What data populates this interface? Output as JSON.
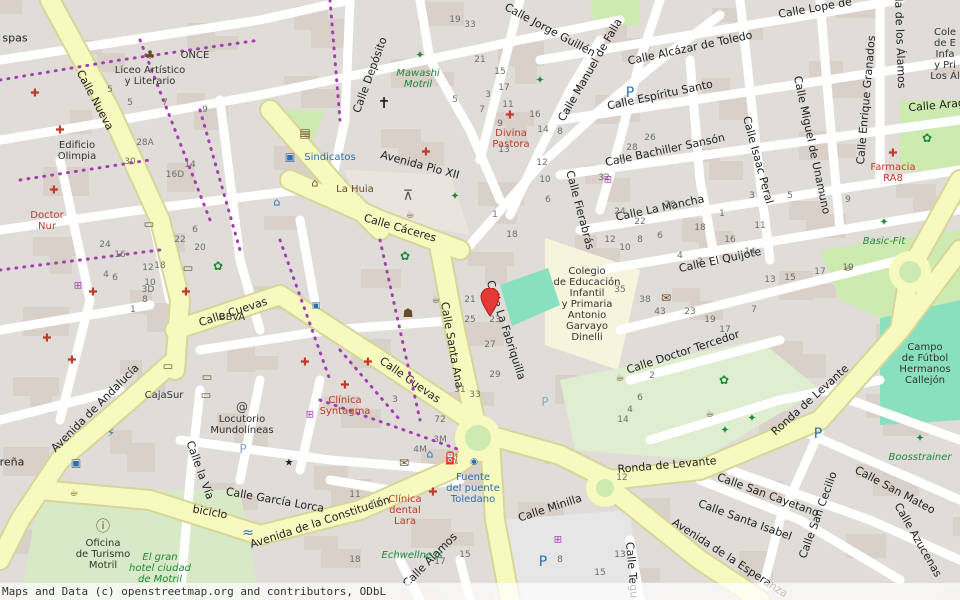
{
  "attribution": "Maps and Data (c) openstreetmap.org and contributors, ODbL",
  "colors": {
    "background": "#f2efe9",
    "block": "#e0dcd8",
    "building": "#d9d0c9",
    "major_road": "#f7fabf",
    "major_road_casing": "#d8d59a",
    "minor_road": "#ffffff",
    "park": "#cdebb0",
    "pitch": "#88e0be",
    "marker": "#e53935",
    "health": "#c0392b",
    "dots": "#a33fb2"
  },
  "marker": {
    "name": "location-pin"
  },
  "streets": [
    {
      "id": "calle-nueva",
      "text": "Calle Nueva"
    },
    {
      "id": "calle-deposito",
      "text": "Calle Depósito"
    },
    {
      "id": "avenida-pio-xii",
      "text": "Avenida Pio XII"
    },
    {
      "id": "calle-caceres",
      "text": "Calle Cáceres"
    },
    {
      "id": "calle-cuevas-1",
      "text": "Calle Cuevas"
    },
    {
      "id": "calle-cuevas-2",
      "text": "Calle Cuevas"
    },
    {
      "id": "calle-santa-ana",
      "text": "Calle Santa Ana"
    },
    {
      "id": "calle-la-fabriquilla",
      "text": "Calle La Fabriquilla"
    },
    {
      "id": "avenida-andalucia",
      "text": "Avenida de Andalucía"
    },
    {
      "id": "calle-la-via",
      "text": "Calle la Vía"
    },
    {
      "id": "calle-garcia-lorca",
      "text": "Calle García Lorca"
    },
    {
      "id": "biciclo",
      "text": "biciclo"
    },
    {
      "id": "avenida-constitucion",
      "text": "Avenida de la Constitución"
    },
    {
      "id": "calle-minilla",
      "text": "Calle Minilla"
    },
    {
      "id": "calle-alamos",
      "text": "Calle Álamos"
    },
    {
      "id": "ronda-levante-1",
      "text": "Ronda de Levante"
    },
    {
      "id": "ronda-levante-2",
      "text": "Ronda de Levante"
    },
    {
      "id": "avenida-esperanza",
      "text": "Avenida de la Esperanza"
    },
    {
      "id": "calle-doctor-tercedor",
      "text": "Calle Doctor Tercedor"
    },
    {
      "id": "calle-el-quijote",
      "text": "Calle El Quijote"
    },
    {
      "id": "calle-la-mancha",
      "text": "Calle La Mancha"
    },
    {
      "id": "calle-bachiller-sanson",
      "text": "Calle Bachiller Sansón"
    },
    {
      "id": "calle-espiritu-santo",
      "text": "Calle Espíritu Santo"
    },
    {
      "id": "calle-alcazar-toledo",
      "text": "Calle Alcázar de Toledo"
    },
    {
      "id": "calle-lope-de",
      "text": "Calle Lope de"
    },
    {
      "id": "calle-jorge-guillen",
      "text": "Calle Jorge Guillén"
    },
    {
      "id": "calle-manuel-falla",
      "text": "Calle Manuel de Falla"
    },
    {
      "id": "calle-fierabras",
      "text": "Calle Fierabrás"
    },
    {
      "id": "calle-isaac-peral",
      "text": "Calle Isaac Peral"
    },
    {
      "id": "calle-miguel-unamuno",
      "text": "Calle Miguel de Unamuno"
    },
    {
      "id": "calle-enrique-granados",
      "text": "Calle Enrique Granados"
    },
    {
      "id": "calle-aragon",
      "text": "Calle Arago"
    },
    {
      "id": "bla-de-los-alamos",
      "text": "bla de los Álamos"
    },
    {
      "id": "calle-san-cayetano",
      "text": "Calle San Cayetano"
    },
    {
      "id": "calle-santa-isabel",
      "text": "Calle Santa Isabel"
    },
    {
      "id": "calle-san-cecilio",
      "text": "Calle San Cecilio"
    },
    {
      "id": "calle-san-mateo",
      "text": "Calle San Mateo"
    },
    {
      "id": "calle-azucenas",
      "text": "Calle Azucenas"
    },
    {
      "id": "calle-tegu",
      "text": "Calle Tegu"
    },
    {
      "id": "calle-espas",
      "text": "spas"
    },
    {
      "id": "calle-rena",
      "text": "reña"
    }
  ],
  "pois": [
    {
      "id": "liceo",
      "text": "Liceo Artístico\ny Literario",
      "style": "dark"
    },
    {
      "id": "once",
      "text": "ONCE",
      "style": "dark"
    },
    {
      "id": "mawashi",
      "text": "Mawashi\nMotril",
      "style": "green"
    },
    {
      "id": "divina-pastora",
      "text": "Divina\nPastora",
      "style": "red"
    },
    {
      "id": "edificio-olimpia",
      "text": "Edificio\nOlimpia",
      "style": "dark"
    },
    {
      "id": "sindicatos",
      "text": "Sindicatos",
      "style": "blue"
    },
    {
      "id": "la-huia",
      "text": "La Huia",
      "style": "brown"
    },
    {
      "id": "doctor-nur",
      "text": "Doctor\nNur",
      "style": "red"
    },
    {
      "id": "bbva",
      "text": "BBVA",
      "style": "dark"
    },
    {
      "id": "colegio",
      "text": "Colegio\nde Educación\nInfantil\ny Primaria\nAntonio\nGarvayo\nDinelli",
      "style": "dark"
    },
    {
      "id": "colegio-top",
      "text": "Cole\nde E\nInfa\ny Pri\nLos Ál",
      "style": "dark"
    },
    {
      "id": "farmacia",
      "text": "Farmacia\nRA8",
      "style": "red"
    },
    {
      "id": "basic-fit",
      "text": "Basic-Fit",
      "style": "green"
    },
    {
      "id": "campo-futbol",
      "text": "Campo\nde Fútbol\nHermanos\nCallejón",
      "style": "dark"
    },
    {
      "id": "cajasur",
      "text": "CajaSur",
      "style": "dark"
    },
    {
      "id": "locutorio",
      "text": "Locutorio\nMundolíneas",
      "style": "dark"
    },
    {
      "id": "clinica-syntagma",
      "text": "Clínica\nSyntagma",
      "style": "red"
    },
    {
      "id": "fuente",
      "text": "Fuente\ndel puente\nToledano",
      "style": "blue"
    },
    {
      "id": "clinica-dental",
      "text": "Clínica\ndental\nLara",
      "style": "red"
    },
    {
      "id": "echwellness",
      "text": "Echwellness",
      "style": "green"
    },
    {
      "id": "oficina-turismo",
      "text": "Oficina\nde Turismo\nMotril",
      "style": "dark"
    },
    {
      "id": "hotel",
      "text": "El gran\nhotel ciudad\nde Motril",
      "style": "green"
    },
    {
      "id": "boosstrainer",
      "text": "Boosstrainer",
      "style": "green"
    }
  ],
  "house_numbers": [
    "5",
    "7",
    "9",
    "5",
    "14",
    "6",
    "28A",
    "30",
    "16D",
    "16",
    "24",
    "22",
    "20",
    "18",
    "12",
    "10",
    "8",
    "6",
    "4",
    "3D",
    "1",
    "33",
    "19",
    "21",
    "17",
    "15",
    "13",
    "11",
    "9",
    "7",
    "5",
    "3",
    "1",
    "18",
    "16",
    "14",
    "12",
    "10",
    "8",
    "6",
    "32",
    "30",
    "28",
    "26",
    "24",
    "22",
    "20",
    "18",
    "16",
    "14",
    "12",
    "10",
    "8",
    "6",
    "4",
    "2",
    "1",
    "3",
    "5",
    "7",
    "9",
    "11",
    "13",
    "15",
    "17",
    "19",
    "21",
    "23",
    "25",
    "27",
    "29",
    "31",
    "33",
    "35",
    "38",
    "43",
    "23",
    "19",
    "17",
    "7",
    "3",
    "72",
    "3M",
    "4M",
    "11",
    "13",
    "15",
    "17",
    "18",
    "15",
    "13",
    "8",
    "12",
    "14",
    "4",
    "6",
    "2"
  ]
}
